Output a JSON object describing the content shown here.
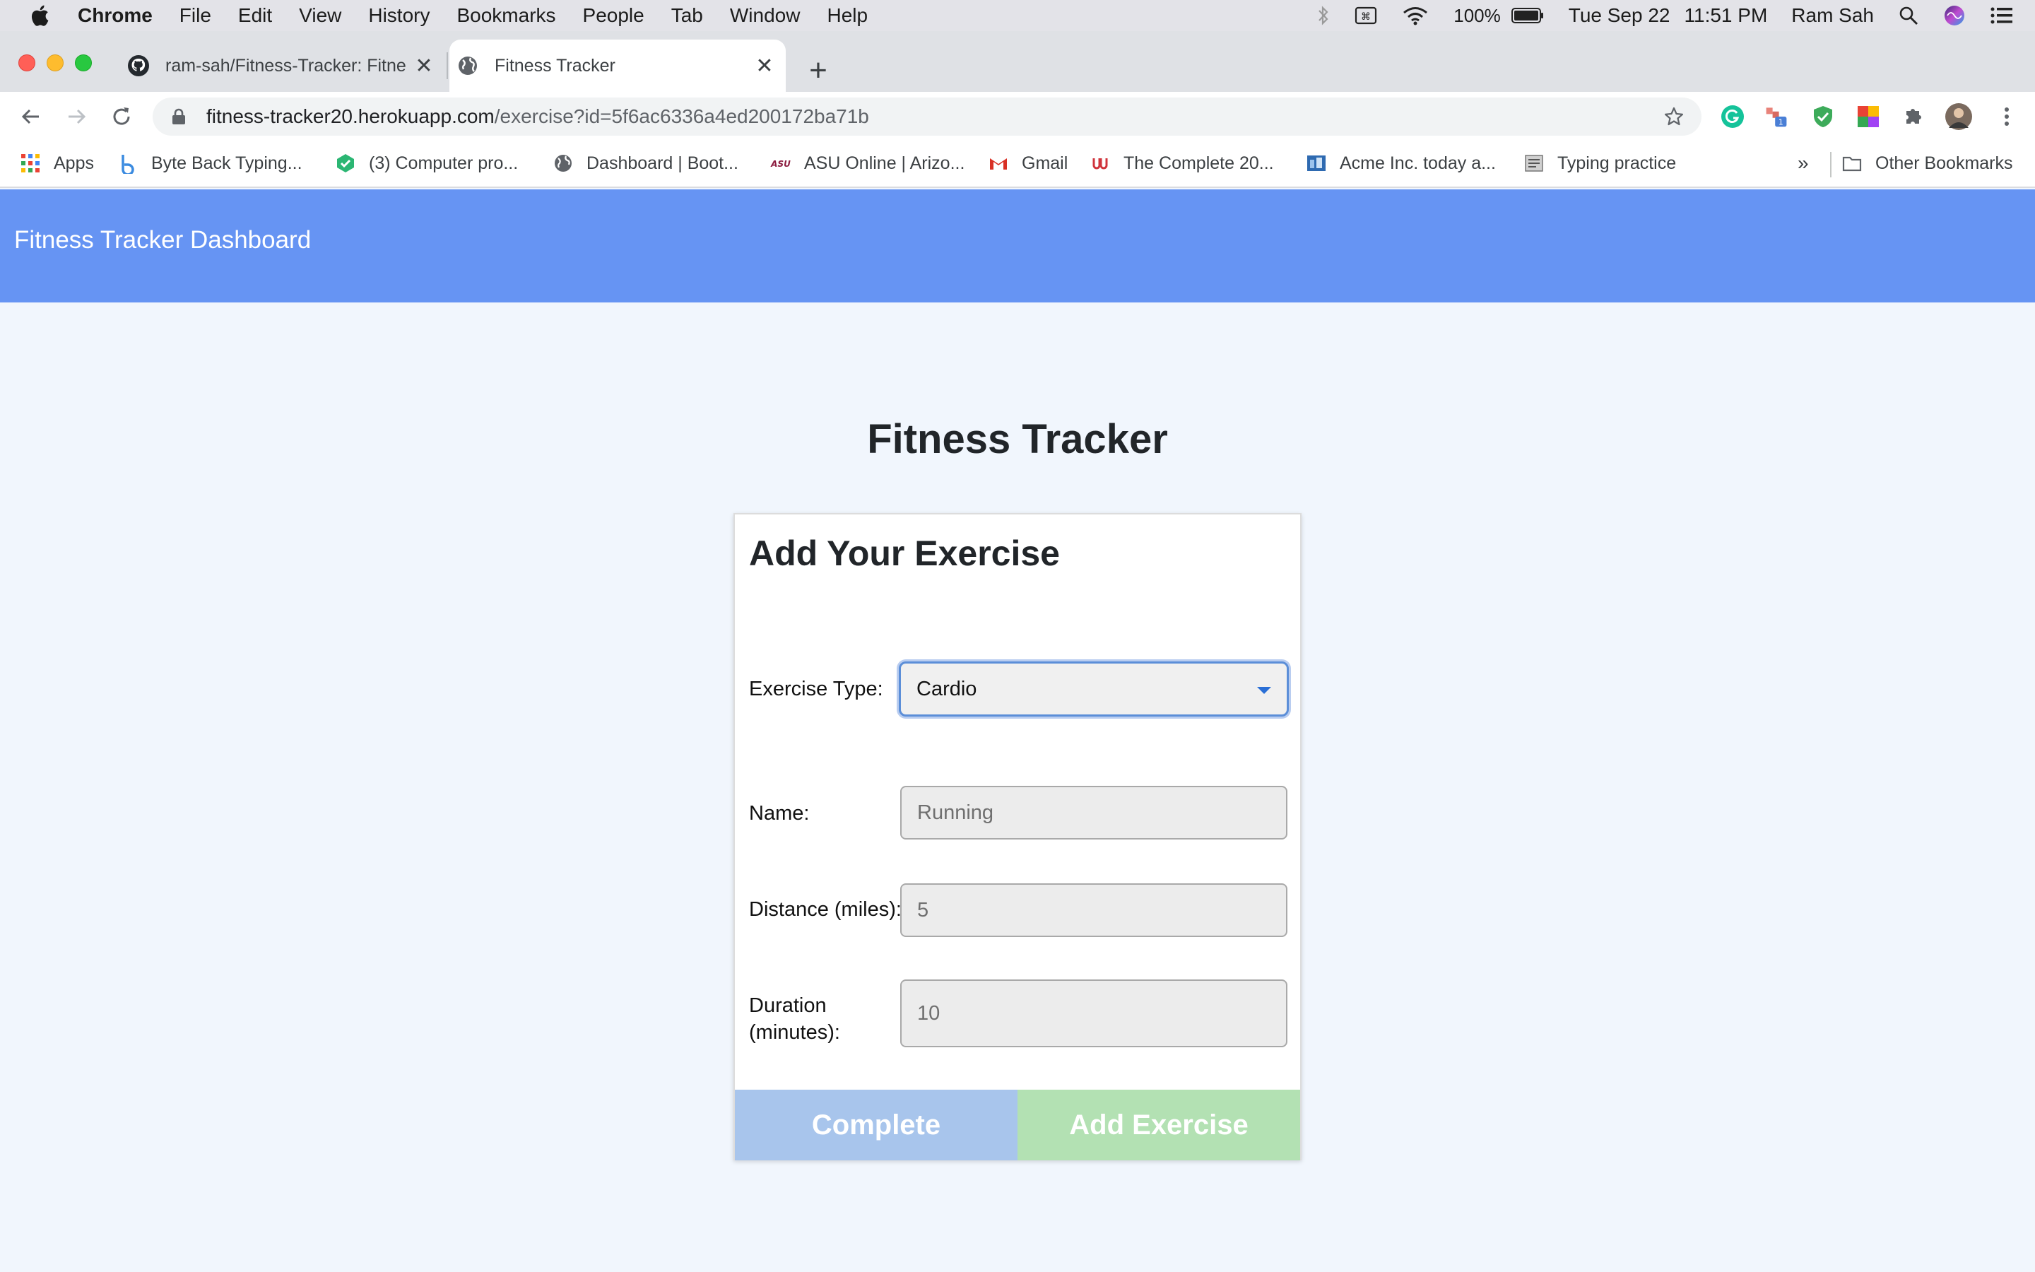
{
  "menubar": {
    "app": "Chrome",
    "items": [
      "File",
      "Edit",
      "View",
      "History",
      "Bookmarks",
      "People",
      "Tab",
      "Window",
      "Help"
    ],
    "battery": "100%",
    "date": "Tue Sep 22",
    "time": "11:51 PM",
    "user": "Ram Sah"
  },
  "tabs": [
    {
      "title": "ram-sah/Fitness-Tracker: Fitne",
      "icon": "github-icon",
      "active": false
    },
    {
      "title": "Fitness Tracker",
      "icon": "globe-icon",
      "active": true
    }
  ],
  "address": {
    "host": "fitness-tracker20.herokuapp.com",
    "path": "/exercise?id=5f6ac6336a4ed200172ba71b"
  },
  "bookmarks": {
    "items": [
      {
        "label": "Apps",
        "icon": "apps-grid-icon"
      },
      {
        "label": "Byte Back Typing...",
        "icon": "byteback-icon"
      },
      {
        "label": "(3) Computer pro...",
        "icon": "hexagon-check-icon"
      },
      {
        "label": "Dashboard | Boot...",
        "icon": "globe-icon"
      },
      {
        "label": "ASU Online | Arizo...",
        "icon": "asu-icon"
      },
      {
        "label": "Gmail",
        "icon": "gmail-icon"
      },
      {
        "label": "The Complete 20...",
        "icon": "udemy-icon"
      },
      {
        "label": "Acme Inc. today a...",
        "icon": "acme-icon"
      },
      {
        "label": "Typing practice",
        "icon": "typing-icon"
      }
    ],
    "overflow": "»",
    "other": "Other Bookmarks"
  },
  "page": {
    "brand": "Fitness Tracker Dashboard",
    "title": "Fitness Tracker",
    "form": {
      "heading": "Add Your Exercise",
      "type_label": "Exercise Type:",
      "type_value": "Cardio",
      "name_label": "Name:",
      "name_placeholder": "Running",
      "distance_label": "Distance (miles):",
      "distance_placeholder": "5",
      "duration_label_line1": "Duration",
      "duration_label_line2": "(minutes):",
      "duration_placeholder": "10",
      "complete_button": "Complete",
      "add_button": "Add Exercise"
    }
  },
  "colors": {
    "navbar": "#6694f3",
    "page_bg": "#f1f6fd",
    "complete_button": "#a8c5ec",
    "add_button": "#b3e1b3"
  }
}
